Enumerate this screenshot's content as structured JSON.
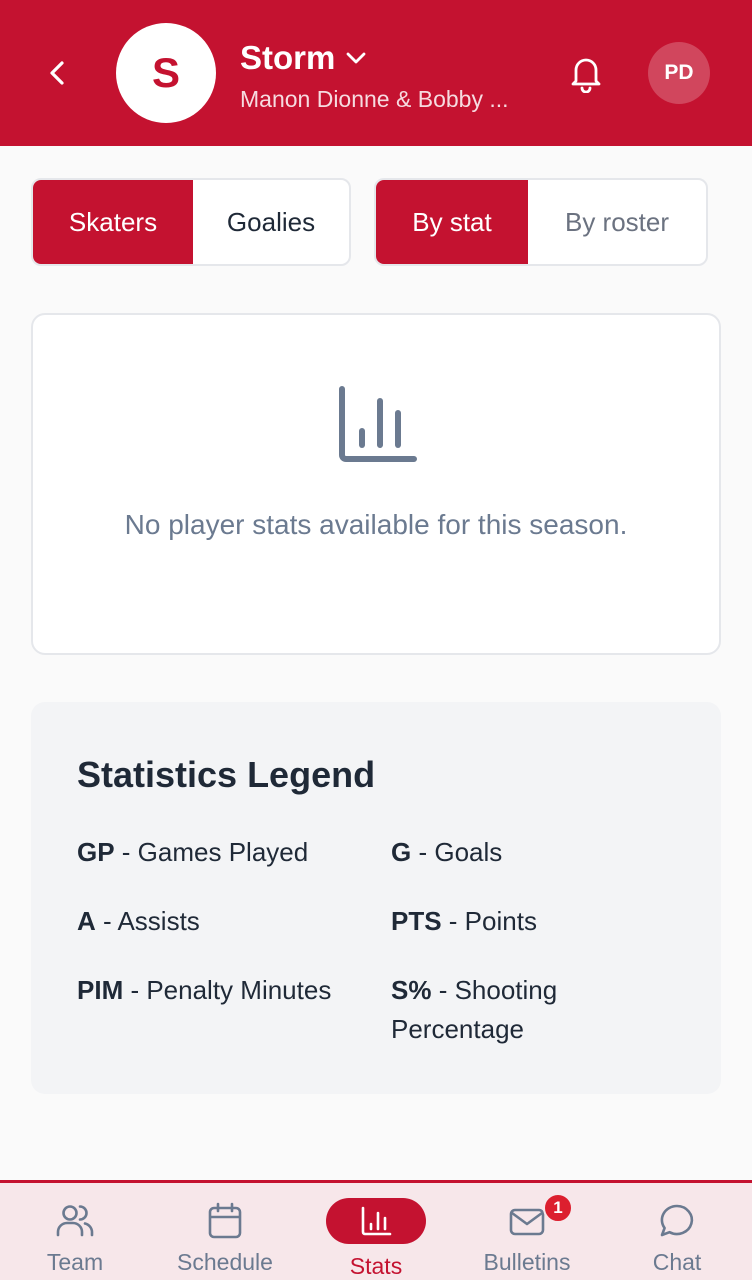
{
  "header": {
    "back_icon": "chevron-left-icon",
    "team_initial": "S",
    "team_name": "Storm",
    "team_subtitle": "Manon Dionne & Bobby ...",
    "notification_icon": "bell-icon",
    "user_initials": "PD",
    "brand_color": "#c41230"
  },
  "filters": {
    "player_type": {
      "options": [
        "Skaters",
        "Goalies"
      ],
      "selected": "Skaters"
    },
    "view_mode": {
      "options": [
        "By stat",
        "By roster"
      ],
      "selected": "By stat"
    }
  },
  "empty_state": {
    "icon": "bar-chart-icon",
    "message": "No player stats available for this season."
  },
  "legend": {
    "title": "Statistics Legend",
    "items": [
      {
        "abbr": "GP",
        "desc": " - Games Played"
      },
      {
        "abbr": "G",
        "desc": " - Goals"
      },
      {
        "abbr": "A",
        "desc": " - Assists"
      },
      {
        "abbr": "PTS",
        "desc": " - Points"
      },
      {
        "abbr": "PIM",
        "desc": " - Penalty Minutes"
      },
      {
        "abbr": "S%",
        "desc": " - Shooting Percentage"
      }
    ]
  },
  "bottom_nav": {
    "items": [
      {
        "label": "Team",
        "icon": "users-icon"
      },
      {
        "label": "Schedule",
        "icon": "calendar-icon"
      },
      {
        "label": "Stats",
        "icon": "bar-chart-icon",
        "active": true
      },
      {
        "label": "Bulletins",
        "icon": "mail-icon",
        "badge": "1"
      },
      {
        "label": "Chat",
        "icon": "chat-bubble-icon"
      }
    ]
  }
}
